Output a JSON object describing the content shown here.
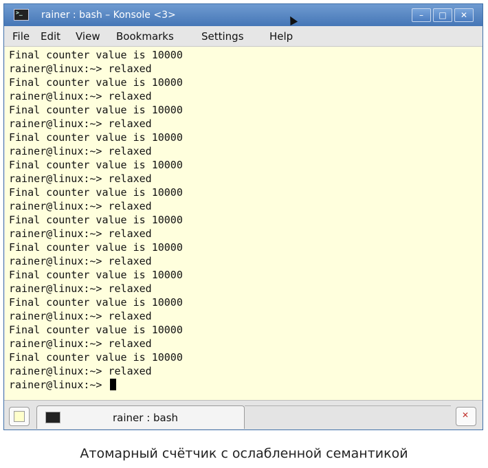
{
  "window": {
    "title": "rainer : bash – Konsole <3>",
    "icon": "terminal-icon",
    "controls": {
      "minimize": "–",
      "maximize": "□",
      "close": "✕"
    }
  },
  "menubar": {
    "items": [
      "File",
      "Edit",
      "View",
      "Bookmarks",
      "Settings",
      "Help"
    ]
  },
  "terminal": {
    "lines": [
      "Final counter value is 10000",
      "rainer@linux:~> relaxed",
      "Final counter value is 10000",
      "rainer@linux:~> relaxed",
      "Final counter value is 10000",
      "rainer@linux:~> relaxed",
      "Final counter value is 10000",
      "rainer@linux:~> relaxed",
      "Final counter value is 10000",
      "rainer@linux:~> relaxed",
      "Final counter value is 10000",
      "rainer@linux:~> relaxed",
      "Final counter value is 10000",
      "rainer@linux:~> relaxed",
      "Final counter value is 10000",
      "rainer@linux:~> relaxed",
      "Final counter value is 10000",
      "rainer@linux:~> relaxed",
      "Final counter value is 10000",
      "rainer@linux:~> relaxed",
      "Final counter value is 10000",
      "rainer@linux:~> relaxed",
      "Final counter value is 10000",
      "rainer@linux:~> relaxed"
    ],
    "prompt": "rainer@linux:~> ",
    "background": "#ffffdd"
  },
  "tabs": {
    "items": [
      {
        "label": "rainer : bash",
        "icon": "terminal-icon"
      }
    ],
    "new_tab_icon": "new-tab-icon",
    "close_tab_icon": "close-tab-icon"
  },
  "caption": "Атомарный счётчик с ослабленной семантикой",
  "colors": {
    "titlebar": "#4f82c4",
    "terminal_bg": "#ffffdd",
    "accent": "#3f6fa8"
  }
}
